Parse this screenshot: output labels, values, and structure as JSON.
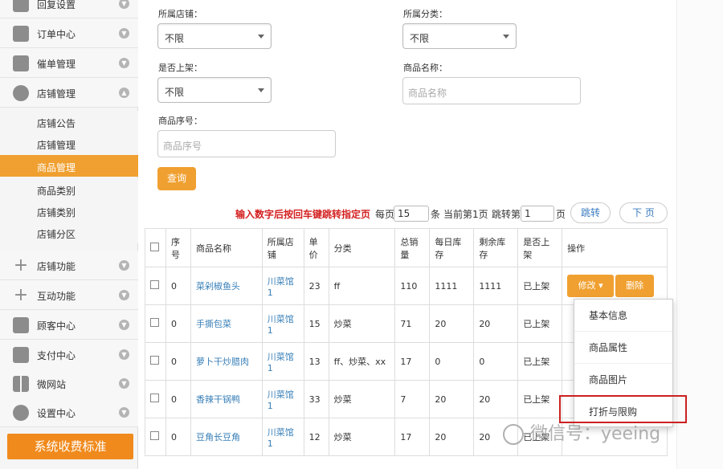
{
  "sidebar": {
    "nav_top": [
      {
        "label": "回复设置",
        "icon": "mail-icon"
      },
      {
        "label": "订单中心",
        "icon": "printer-icon"
      },
      {
        "label": "催单管理",
        "icon": "printer-icon"
      },
      {
        "label": "店铺管理",
        "icon": "pie-chart-icon"
      }
    ],
    "sub_items": [
      "店铺公告",
      "店铺管理",
      "商品管理",
      "商品类别",
      "店铺类别",
      "店铺分区"
    ],
    "nav_bottom": [
      {
        "label": "店铺功能",
        "icon": "plus-icon"
      },
      {
        "label": "互动功能",
        "icon": "plus-icon"
      },
      {
        "label": "顾客中心",
        "icon": "card-icon"
      },
      {
        "label": "支付中心",
        "icon": "inbox-icon"
      },
      {
        "label": "微网站",
        "icon": "grid-icon"
      },
      {
        "label": "设置中心",
        "icon": "gear-icon"
      }
    ],
    "fee_button": "系统收费标准"
  },
  "filters": {
    "store_label": "所属店铺：",
    "store_value": "不限",
    "category_label": "所属分类：",
    "category_value": "不限",
    "listed_label": "是否上架：",
    "listed_value": "不限",
    "name_label": "商品名称：",
    "name_placeholder": "商品名称",
    "serial_label": "商品序号：",
    "serial_placeholder": "商品序号",
    "query_button": "查询"
  },
  "pager": {
    "hint": "输入数字后按回车键跳转指定页",
    "per_page_prefix": "每页",
    "per_page_value": "15",
    "per_page_suffix": "条",
    "current_page": "当前第1页",
    "jump_prefix": "跳转第",
    "jump_value": "1",
    "jump_suffix": "页",
    "jump_button": "跳转",
    "next_button": "下 页"
  },
  "table": {
    "headers": [
      "序号",
      "商品名称",
      "所属店铺",
      "单价",
      "分类",
      "总销量",
      "每日库存",
      "剩余库存",
      "是否上架",
      "操作"
    ],
    "rows": [
      {
        "seq": "0",
        "name": "菜剁椒鱼头",
        "store": "川菜馆1",
        "price": "23",
        "category": "ff",
        "total": "110",
        "daily": "1111",
        "remaining": "1111",
        "listed": "已上架"
      },
      {
        "seq": "0",
        "name": "手撕包菜",
        "store": "川菜馆1",
        "price": "15",
        "category": "炒菜",
        "total": "71",
        "daily": "20",
        "remaining": "20",
        "listed": "已上架"
      },
      {
        "seq": "0",
        "name": "萝卜干炒腊肉",
        "store": "川菜馆1",
        "price": "13",
        "category": "ff、炒菜、xx",
        "total": "17",
        "daily": "0",
        "remaining": "0",
        "listed": "已上架"
      },
      {
        "seq": "0",
        "name": "香辣干锅鸭",
        "store": "川菜馆1",
        "price": "33",
        "category": "炒菜",
        "total": "7",
        "daily": "20",
        "remaining": "20",
        "listed": "已上架"
      },
      {
        "seq": "0",
        "name": "豆角长豆角",
        "store": "川菜馆1",
        "price": "12",
        "category": "炒菜",
        "total": "17",
        "daily": "20",
        "remaining": "20",
        "listed": "已上架"
      }
    ],
    "edit_button": "修改 ▾",
    "delete_button": "删除"
  },
  "dropdown": {
    "items": [
      "基本信息",
      "商品属性",
      "商品图片",
      "打折与限购"
    ]
  },
  "watermark": "微信号：yeeing"
}
